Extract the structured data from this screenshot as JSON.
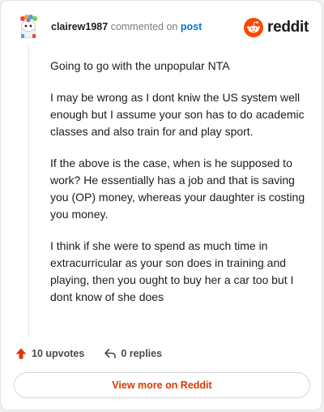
{
  "comment": {
    "username": "clairew1987",
    "action_text": "commented on",
    "post_link": "post",
    "paragraphs": [
      "Going to go with the unpopular NTA",
      "I may be wrong as I dont kniw the US system well enough but I assume your son has to do academic classes and also train for and play sport.",
      "If the above is the case, when is he supposed to work? He essentially has a job and that is saving you (OP) money, whereas your daughter is costing you money.",
      "I think if she were to spend as much time in extracurricular as your son does in training and playing, then you ought to buy her a car too but I dont know of she does"
    ]
  },
  "brand": {
    "name": "reddit",
    "icon": "reddit-snoo-icon",
    "color": "#ff4500"
  },
  "actions": {
    "upvotes_label": "10 upvotes",
    "upvote_icon": "upvote-arrow-icon",
    "replies_label": "0 replies",
    "reply_icon": "reply-arrow-icon",
    "upvote_color": "#d93a00"
  },
  "footer": {
    "view_more_label": "View more on Reddit"
  }
}
